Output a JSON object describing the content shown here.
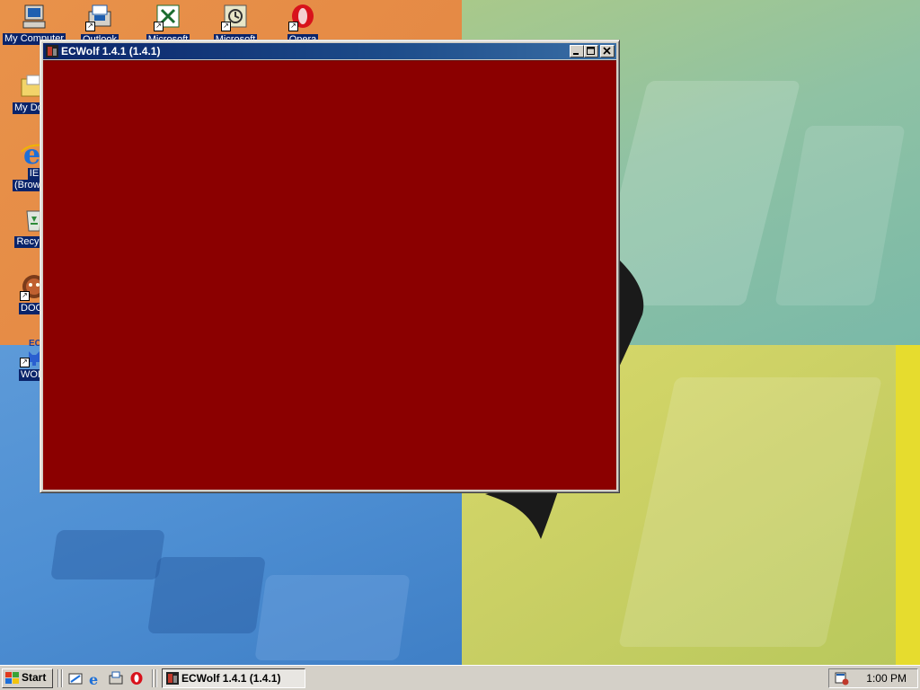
{
  "desktop": {
    "icons": [
      {
        "label": "My Computer"
      },
      {
        "label": "Outlook"
      },
      {
        "label": "Microsoft"
      },
      {
        "label": "Microsoft"
      },
      {
        "label": "Opera"
      },
      {
        "label": "My Documents"
      },
      {
        "label": "IE"
      },
      {
        "label": "(Browser)"
      },
      {
        "label": "Recycle"
      },
      {
        "label": "DOOM"
      },
      {
        "label": "WOLF"
      },
      {
        "label": "EC"
      }
    ]
  },
  "window": {
    "title": "ECWolf 1.4.1 (1.4.1)",
    "client_color": "#8b0000"
  },
  "taskbar": {
    "start_label": "Start",
    "task_label": "ECWolf 1.4.1 (1.4.1)",
    "clock": "1:00 PM",
    "quick_launch": [
      "show-desktop-icon",
      "ie-icon",
      "outlook-icon",
      "opera-icon"
    ]
  },
  "colors": {
    "titlebar": "#0a246a",
    "face": "#d4d0c8",
    "selection": "#0a246a"
  }
}
